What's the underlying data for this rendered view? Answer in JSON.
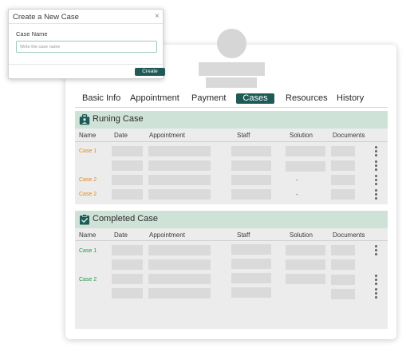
{
  "modal": {
    "title": "Create a New Case",
    "close_icon": "×",
    "field_label": "Case Name",
    "field_placeholder": "Write the case name",
    "field_value": "",
    "create_label": "Create"
  },
  "tabs": [
    {
      "label": "Basic Info",
      "active": false
    },
    {
      "label": "Appointment",
      "active": false
    },
    {
      "label": "Payment",
      "active": false
    },
    {
      "label": "Cases",
      "active": true
    },
    {
      "label": "Resources",
      "active": false
    },
    {
      "label": "History",
      "active": false
    }
  ],
  "columns": [
    "Name",
    "Date",
    "Appointment",
    "Staff",
    "Solution",
    "Documents"
  ],
  "running": {
    "title": "Runing Case",
    "icon": "briefcase-user-icon",
    "rows": [
      {
        "name": "Case 1",
        "solution": ""
      },
      {
        "name": "",
        "solution": ""
      },
      {
        "name": "Case 2",
        "solution": "-"
      },
      {
        "name": "Case 2",
        "solution": "-"
      }
    ]
  },
  "completed": {
    "title": "Completed Case",
    "icon": "clipboard-check-icon",
    "rows": [
      {
        "name": "Case 1",
        "solution": ""
      },
      {
        "name": "",
        "solution": ""
      },
      {
        "name": "Case 2",
        "solution": ""
      },
      {
        "name": "",
        "solution": ""
      }
    ]
  },
  "colors": {
    "accent": "#1f5a57",
    "section_header": "#cfe2d8",
    "running_case_text": "#e08a1e",
    "completed_case_text": "#1f9a4e"
  }
}
